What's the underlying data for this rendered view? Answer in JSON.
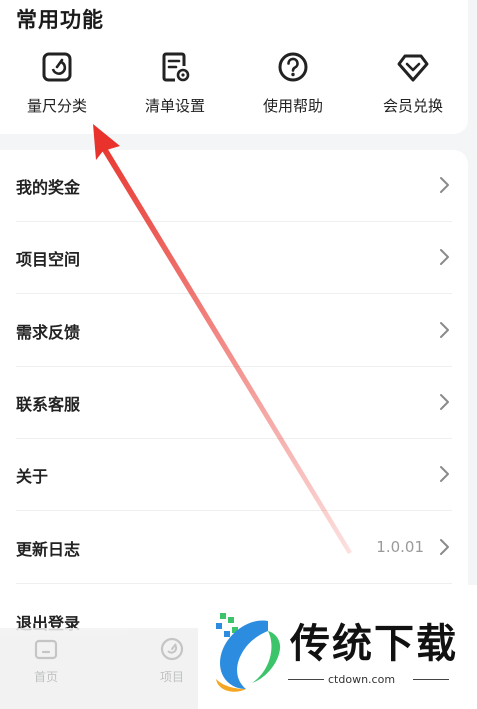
{
  "common": {
    "title": "常用功能",
    "items": [
      {
        "label": "量尺分类",
        "icon": "measure-icon"
      },
      {
        "label": "清单设置",
        "icon": "list-settings-icon"
      },
      {
        "label": "使用帮助",
        "icon": "help-icon"
      },
      {
        "label": "会员兑换",
        "icon": "diamond-icon"
      }
    ]
  },
  "menu": {
    "items": [
      {
        "label": "我的奖金",
        "value": ""
      },
      {
        "label": "项目空间",
        "value": ""
      },
      {
        "label": "需求反馈",
        "value": ""
      },
      {
        "label": "联系客服",
        "value": ""
      },
      {
        "label": "关于",
        "value": ""
      },
      {
        "label": "更新日志",
        "value": "1.0.01"
      },
      {
        "label": "退出登录",
        "value": ""
      }
    ]
  },
  "tabbar": {
    "items": [
      {
        "label": "首页",
        "icon": "home-icon"
      },
      {
        "label": "项目",
        "icon": "project-icon"
      }
    ]
  },
  "watermark": {
    "text": "传统下载",
    "url": "ctdown.com"
  },
  "colors": {
    "annotation_arrow": "#e8322b",
    "logo_blue": "#2c8de0",
    "logo_green": "#3cc46a",
    "logo_orange": "#f5a623"
  }
}
